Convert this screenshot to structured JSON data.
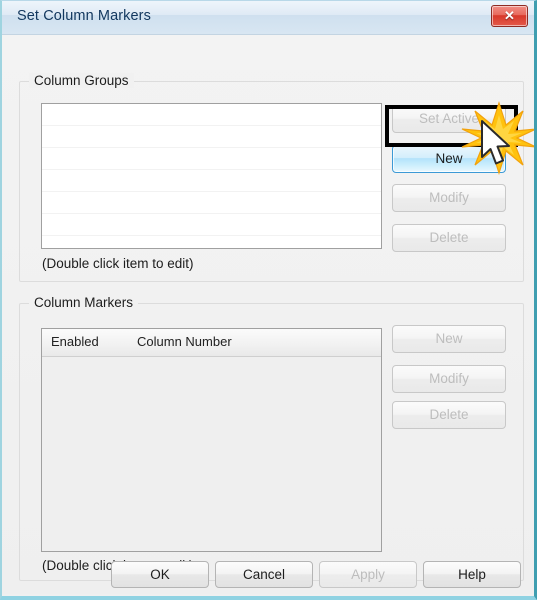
{
  "window": {
    "title": "Set Column Markers",
    "close_label": "✕",
    "close_icon": "close-icon"
  },
  "colors": {
    "title_text": "#12375e",
    "titlebar_top": "#eef5fb",
    "close_button": "#d8382a",
    "frame_accent": "#3f9eb0",
    "highlight_box": "#000000",
    "starburst": "#ffc20e",
    "hover_button": "#b3e2fb"
  },
  "column_groups": {
    "group_title": "Column Groups",
    "hint": "(Double click item to edit)",
    "list_items": [],
    "buttons": [
      {
        "label": "Set Active",
        "state": "disabled"
      },
      {
        "label": "New",
        "state": "hover"
      },
      {
        "label": "Modify",
        "state": "disabled"
      },
      {
        "label": "Delete",
        "state": "disabled"
      }
    ]
  },
  "column_markers": {
    "group_title": "Column Markers",
    "hint": "(Double click item to edit)",
    "columns": [
      "Enabled",
      "Column Number"
    ],
    "rows": [],
    "buttons": [
      {
        "label": "New",
        "state": "disabled"
      },
      {
        "label": "Modify",
        "state": "disabled"
      },
      {
        "label": "Delete",
        "state": "disabled"
      }
    ]
  },
  "footer": {
    "buttons": [
      {
        "label": "OK",
        "state": "enabled"
      },
      {
        "label": "Cancel",
        "state": "enabled"
      },
      {
        "label": "Apply",
        "state": "disabled"
      },
      {
        "label": "Help",
        "state": "enabled"
      }
    ]
  },
  "annotation": {
    "highlighted_control": "New",
    "cursor_icon": "mouse-pointer-icon",
    "click_icon": "click-burst-icon"
  }
}
